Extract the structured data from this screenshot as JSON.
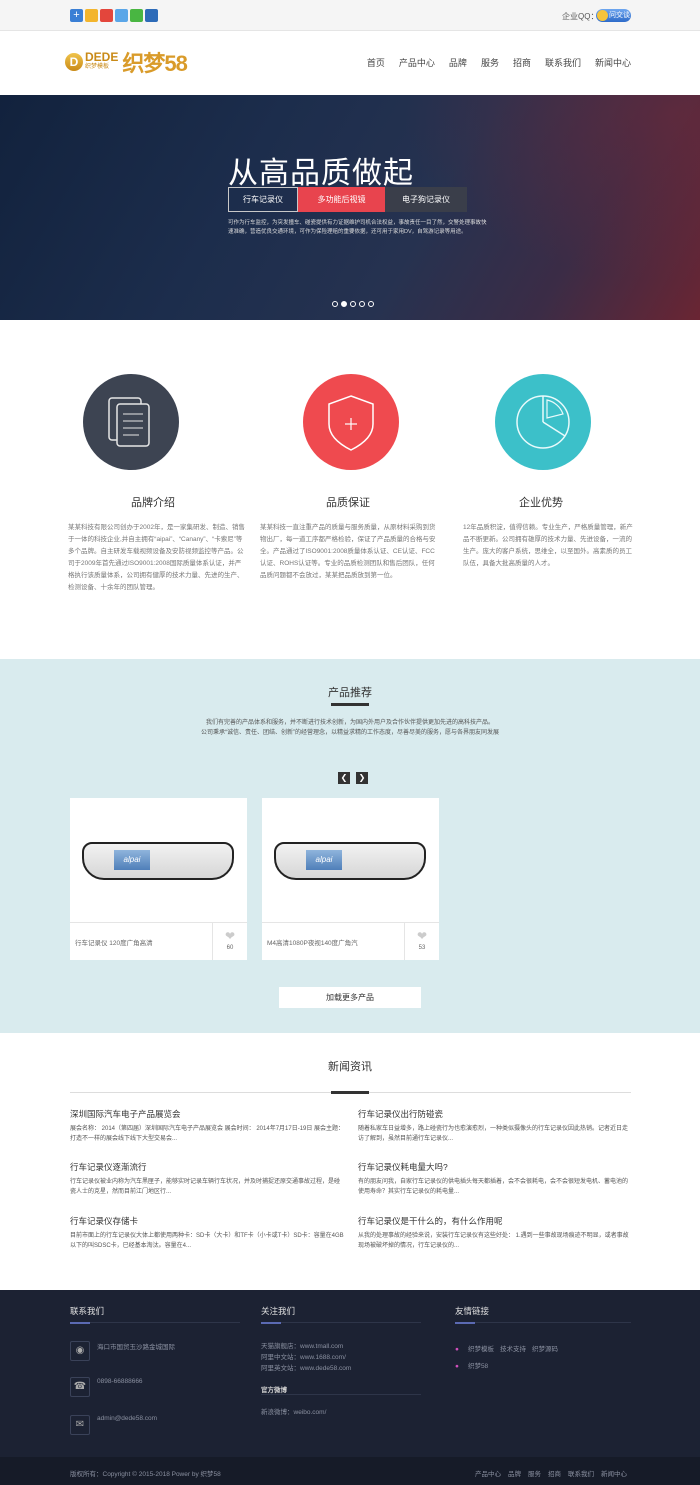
{
  "topbar": {
    "share_icons": [
      "share-plus-icon",
      "qzone-star-icon",
      "weibo-icon",
      "tencent-weibo-icon",
      "wechat-icon",
      "renren-icon"
    ],
    "qq_label": "企业QQ：",
    "qq_button": "问交谈"
  },
  "header": {
    "logo_dede": "DEDE",
    "logo_small": "织梦模板",
    "logo_cn": "织梦58",
    "nav": [
      "首页",
      "产品中心",
      "品牌",
      "服务",
      "招商",
      "联系我们",
      "新闻中心"
    ]
  },
  "banner": {
    "title": "从高品质做起",
    "tabs": [
      "行车记录仪",
      "多功能后视镜",
      "电子狗记录仪"
    ],
    "desc": "可作为行车监控，为突发撞车、碰瓷提供有力证据维护司机合法权益，事故责任一目了然，交警处理事故快速准确，营造优良交通环境，可作为保险理赔的重要依据，还可用于家用DV，自驾游记录等用途。",
    "dots": 5,
    "active_dot": 1
  },
  "features": [
    {
      "title": "品牌介绍",
      "color": "#3d4452",
      "icon": "document-icon",
      "text": "某某科技有限公司创办于2002年，是一家集研发、制造、销售于一体的科技企业,并自主拥有“aipai”、“Canany”、“卡索尼”等多个品牌。自主研发车载视频设备及安防视频监控等产品。公司于2009年首先通过ISO9001:2008国际质量体系认证，并严格执行该质量体系，公司拥有健厚的技术力量、先进的生产、检测设备、十余年的团队管理。"
    },
    {
      "title": "品质保证",
      "color": "#ef4a4f",
      "icon": "shield-icon",
      "text": "某某科技一直注重产品的质量与服务质量，从原材料采购到货物出厂，每一道工序都严格检验，保证了产品质量的合格与安全。产品通过了ISO9001:2008质量体系认证、CE认证、FCC认证、ROHS认证等。专业的品质检测团队和售后团队，任何品质问题都不会放过，某某把品质放到第一位。"
    },
    {
      "title": "企业优势",
      "color": "#3cc0c9",
      "icon": "pie-chart-icon",
      "text": "12年品质积淀，值得信赖。专业生产，严格质量管理，新产品不断更新。公司拥有雄厚的技术力量、先进设备，一流的生产。庞大的客户系统，思维全，以至国外。高素质的员工队伍，具备大批高质量的人才。"
    }
  ],
  "products": {
    "title": "产品推荐",
    "desc_line1": "我们有完善的产品体系和服务，并不断进行技术创新，为国内外用户及合作伙伴提供更加先进的高科技产品。",
    "desc_line2": "公司秉承“诚信、责任、团结、创新”的经营理念，以精益求精的工作态度，尽善尽美的服务，愿与各界朋友同发展",
    "items": [
      {
        "name": "行车记录仪 120度广角高清",
        "likes": "60",
        "screen_label": "alpai"
      },
      {
        "name": "M4高清1080P夜视140度广角汽",
        "likes": "53",
        "screen_label": "alpai"
      }
    ],
    "more_button": "加载更多产品"
  },
  "news": {
    "title": "新闻资讯",
    "items": [
      {
        "title": "深圳国际汽车电子产品展览会",
        "summary": "展会名称： 2014（第四届）深圳国际汽车电子产品展览会 展会时间： 2014年7月17日-19日 展会主题： 打造不一样的展会线下线下大型交易会..."
      },
      {
        "title": "行车记录仪出行防碰瓷",
        "summary": "随着私家车日益增多，路上碰瓷行为也愈演愈烈，一种类似摄像头的行车记录仪因此热销。记者近日走访了解到，虽然目前通行车记录仪..."
      },
      {
        "title": "行车记录仪逐渐流行",
        "summary": "行车记录仪被业内称为汽车黑匣子，能够实时记录车辆行车状况，并及时捕捉还原交通事故过程，是碰瓷人士的克星，然而目前江门地区行..."
      },
      {
        "title": "行车记录仪耗电量大吗?",
        "summary": "有的朋友问我，自家行车记录仪的供电插头每天都插着，会不会很耗电，会不会很短发电机、蓄电池的使用寿命？其实行车记录仪的耗电量..."
      },
      {
        "title": "行车记录仪存储卡",
        "summary": "目前市面上的行车记录仪大体上都使用两种卡：SD卡（大卡）和TF卡（小卡或T卡）SD卡：容量在4GB以下的叫SDSC卡，已经基本淘汰。容量在4..."
      },
      {
        "title": "行车记录仪是干什么的，有什么作用呢",
        "summary": "从我的处理事故的经验来说，安装行车记录仪有这些好处： 1.遇到一些事故现场痕迹不明显，或者事故现场被破坏掉的情况，行车记录仪的..."
      }
    ]
  },
  "footer": {
    "contact_title": "联系我们",
    "address": "海口市国贸玉沙路金城国际",
    "phone": "0898-66888666",
    "email": "admin@dede58.com",
    "follow_title": "关注我们",
    "follow_lines": [
      "天猫旗舰店：www.tmall.com",
      "阿里中文站：www.1688.com/",
      "阿里英文站：www.dede58.com"
    ],
    "weibo_title": "官方微博",
    "weibo_line": "新浪微博：weibo.com/",
    "friends_title": "友情链接",
    "friend_line1": [
      "织梦模板",
      "技术支持",
      "织梦源码"
    ],
    "friend_line2": [
      "织梦58"
    ],
    "copyright": "版权所有：Copyright © 2015-2018 Power by 织梦58",
    "bottom_nav": [
      "产品中心",
      "品牌",
      "服务",
      "招商",
      "联系我们",
      "新闻中心"
    ]
  }
}
